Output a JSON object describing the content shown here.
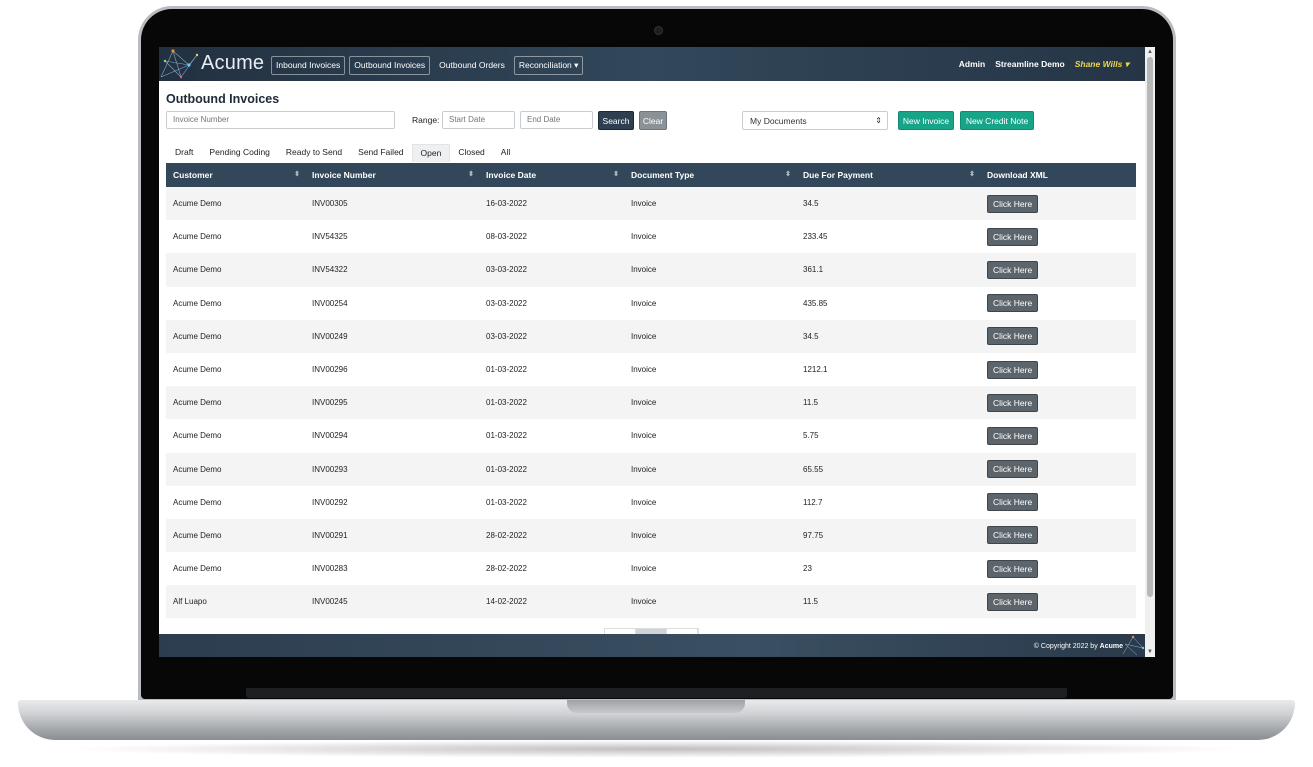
{
  "brand": {
    "name": "Acume"
  },
  "nav": {
    "links": [
      "Inbound Invoices",
      "Outbound Invoices",
      "Outbound Orders",
      "Reconciliation"
    ],
    "right": {
      "admin": "Admin",
      "company": "Streamline Demo",
      "user": "Shane Wills"
    }
  },
  "page": {
    "title": "Outbound Invoices"
  },
  "filters": {
    "invoice_placeholder": "Invoice Number",
    "range_label": "Range:",
    "start_placeholder": "Start Date",
    "end_placeholder": "End Date",
    "search_label": "Search",
    "clear_label": "Clear",
    "doc_select": "My Documents",
    "new_invoice_label": "New Invoice",
    "new_credit_label": "New Credit Note"
  },
  "tabs": [
    "Draft",
    "Pending Coding",
    "Ready to Send",
    "Send Failed",
    "Open",
    "Closed",
    "All"
  ],
  "active_tab": "Open",
  "table": {
    "headers": [
      "Customer",
      "Invoice Number",
      "Invoice Date",
      "Document Type",
      "Due For Payment",
      "Download XML"
    ],
    "button_label": "Click Here",
    "rows": [
      [
        "Acume Demo",
        "INV00305",
        "16-03-2022",
        "Invoice",
        "34.5"
      ],
      [
        "Acume Demo",
        "INV54325",
        "08-03-2022",
        "Invoice",
        "233.45"
      ],
      [
        "Acume Demo",
        "INV54322",
        "03-03-2022",
        "Invoice",
        "361.1"
      ],
      [
        "Acume Demo",
        "INV00254",
        "03-03-2022",
        "Invoice",
        "435.85"
      ],
      [
        "Acume Demo",
        "INV00249",
        "03-03-2022",
        "Invoice",
        "34.5"
      ],
      [
        "Acume Demo",
        "INV00296",
        "01-03-2022",
        "Invoice",
        "1212.1"
      ],
      [
        "Acume Demo",
        "INV00295",
        "01-03-2022",
        "Invoice",
        "11.5"
      ],
      [
        "Acume Demo",
        "INV00294",
        "01-03-2022",
        "Invoice",
        "5.75"
      ],
      [
        "Acume Demo",
        "INV00293",
        "01-03-2022",
        "Invoice",
        "65.55"
      ],
      [
        "Acume Demo",
        "INV00292",
        "01-03-2022",
        "Invoice",
        "112.7"
      ],
      [
        "Acume Demo",
        "INV00291",
        "28-02-2022",
        "Invoice",
        "97.75"
      ],
      [
        "Acume Demo",
        "INV00283",
        "28-02-2022",
        "Invoice",
        "23"
      ],
      [
        "Alf Luapo",
        "INV00245",
        "14-02-2022",
        "Invoice",
        "11.5"
      ]
    ]
  },
  "footer": {
    "prefix": "© Copyright 2022 by ",
    "brand": "Acume"
  },
  "colors": {
    "nav": "#32475a",
    "accent_green": "#17a589",
    "user_name": "#f0d54a"
  }
}
